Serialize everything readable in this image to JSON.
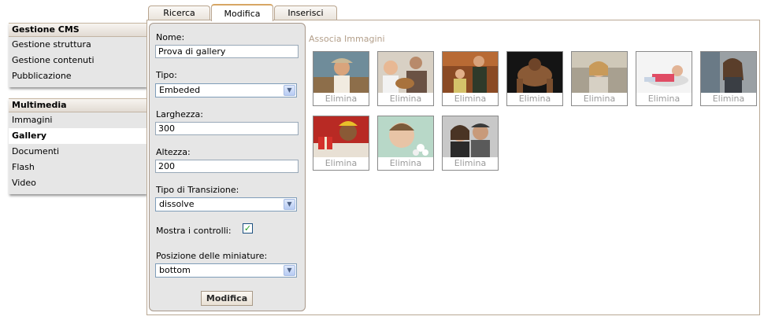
{
  "sidebar": {
    "cms": {
      "header": "Gestione CMS",
      "items": [
        {
          "label": "Gestione struttura"
        },
        {
          "label": "Gestione contenuti"
        },
        {
          "label": "Pubblicazione"
        }
      ]
    },
    "multimedia": {
      "header": "Multimedia",
      "items": [
        {
          "label": "Immagini",
          "active": false
        },
        {
          "label": "Gallery",
          "active": true
        },
        {
          "label": "Documenti",
          "active": false
        },
        {
          "label": "Flash",
          "active": false
        },
        {
          "label": "Video",
          "active": false
        }
      ]
    }
  },
  "tabs": [
    {
      "label": "Ricerca",
      "active": false
    },
    {
      "label": "Modifica",
      "active": true
    },
    {
      "label": "Inserisci",
      "active": false
    }
  ],
  "form": {
    "nome_label": "Nome:",
    "nome_value": "Prova di gallery",
    "tipo_label": "Tipo:",
    "tipo_value": "Embeded",
    "larghezza_label": "Larghezza:",
    "larghezza_value": "300",
    "altezza_label": "Altezza:",
    "altezza_value": "200",
    "transizione_label": "Tipo di Transizione:",
    "transizione_value": "dissolve",
    "controlli_label": "Mostra i controlli:",
    "controlli_checked": true,
    "posizione_label": "Posizione delle miniature:",
    "posizione_value": "bottom",
    "submit_label": "Modifica"
  },
  "gallery": {
    "title": "Associa Immagini",
    "delete_label": "Elimina",
    "thumbnails": [
      {
        "subject": "woman-smiling-hat"
      },
      {
        "subject": "child-with-guitar"
      },
      {
        "subject": "family-indoor"
      },
      {
        "subject": "athlete-pushup"
      },
      {
        "subject": "girl-laughing"
      },
      {
        "subject": "woman-on-phone-lying"
      },
      {
        "subject": "woman-on-phone-office"
      },
      {
        "subject": "man-with-christmas-gifts"
      },
      {
        "subject": "child-face-bubbles"
      },
      {
        "subject": "couple-portrait"
      }
    ]
  },
  "colors": {
    "accent": "#d7a664",
    "border": "#b9a894",
    "caption": "#9a9a9a",
    "gallery_title": "#b39f8a",
    "panel_bg": "#e6e6e6"
  }
}
